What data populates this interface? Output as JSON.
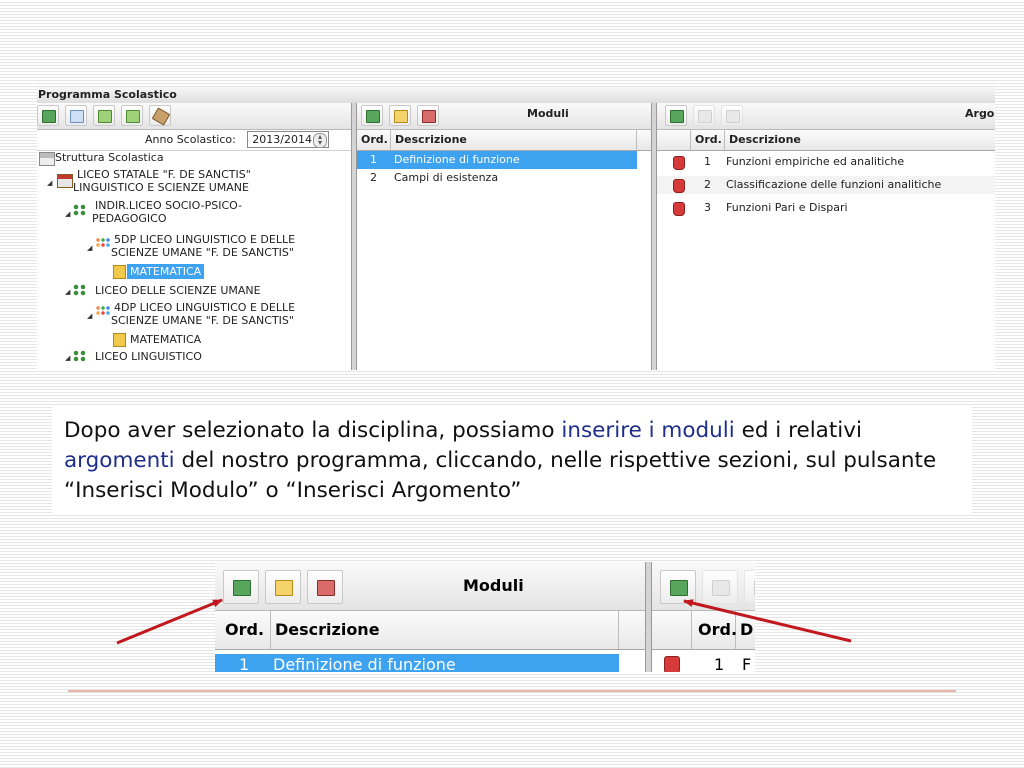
{
  "screenshot1": {
    "window_title": "Programma Scolastico",
    "left_pane": {
      "toolbar_icons": [
        "exit-icon",
        "document-icon",
        "upload-icon",
        "upload-alt-icon",
        "brush-icon"
      ],
      "anno_label": "Anno Scolastico:",
      "anno_value": "2013/2014",
      "tree": [
        {
          "label": "Struttura Scolastica",
          "icon": "school-root-icon"
        },
        {
          "label": "LICEO STATALE \"F. DE SANCTIS\"",
          "label2": "LINGUISTICO E SCIENZE UMANE",
          "icon": "building-icon"
        },
        {
          "label": "INDIR.LICEO SOCIO-PSICO-",
          "label2": "PEDAGOGICO",
          "icon": "group-icon"
        },
        {
          "label": "5DP LICEO LINGUISTICO E DELLE",
          "label2": "SCIENZE UMANE \"F. DE SANCTIS\"",
          "icon": "class-icon"
        },
        {
          "label": "MATEMATICA",
          "icon": "book-icon",
          "selected": true
        },
        {
          "label": "LICEO DELLE SCIENZE UMANE",
          "icon": "group-icon"
        },
        {
          "label": "4DP LICEO LINGUISTICO E DELLE",
          "label2": "SCIENZE UMANE \"F. DE SANCTIS\"",
          "icon": "class-icon"
        },
        {
          "label": "MATEMATICA",
          "icon": "book-icon"
        },
        {
          "label": "LICEO LINGUISTICO",
          "icon": "group-icon"
        }
      ]
    },
    "mid_pane": {
      "title": "Moduli",
      "col_ord": "Ord.",
      "col_desc": "Descrizione",
      "rows": [
        {
          "ord": "1",
          "desc": "Definizione di funzione",
          "selected": true
        },
        {
          "ord": "2",
          "desc": "Campi di esistenza"
        }
      ]
    },
    "right_pane": {
      "title": "Argo",
      "col_ord": "Ord.",
      "col_desc": "Descrizione",
      "rows": [
        {
          "ord": "1",
          "desc": "Funzioni empiriche ed analitiche"
        },
        {
          "ord": "2",
          "desc": "Classificazione delle funzioni analitiche"
        },
        {
          "ord": "3",
          "desc": "Funzioni Pari e Dispari"
        }
      ]
    }
  },
  "paragraph": {
    "part1": "Dopo aver selezionato la disciplina, possiamo ",
    "hl1": "inserire i moduli",
    "part2": " ed i relativi ",
    "hl2": "argomenti",
    "part3": " del nostro programma, cliccando, nelle rispettive sezioni, sul pulsante “Inserisci Modulo” o “Inserisci Argomento”"
  },
  "screenshot2": {
    "mid_title": "Moduli",
    "col_ord": "Ord.",
    "col_desc": "Descrizione",
    "row_ord": "1",
    "row_desc": "Definizione di funzione",
    "right_col_ord": "Ord.",
    "right_col_desc_partial": "D",
    "right_row_ord": "1",
    "right_row_desc_partial": "F"
  },
  "colors": {
    "selection": "#3da2ef",
    "highlight_text": "#1e2f8a",
    "arrow": "#c0181e",
    "footer_line": "#e3b8a8"
  }
}
